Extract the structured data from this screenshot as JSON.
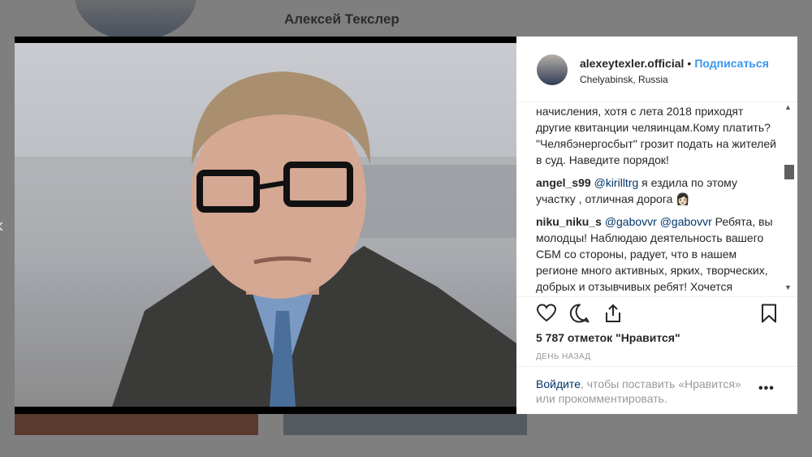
{
  "background": {
    "profile_name": "Алексей Текслер"
  },
  "post": {
    "username": "alexeytexler.official",
    "separator": "•",
    "follow_label": "Подписаться",
    "location": "Chelyabinsk, Russia",
    "comments": [
      {
        "user": "",
        "text": "начисления, хотя с лета 2018 приходят другие квитанции челяинцам.Кому платить? \"Челябэнергосбыт\" грозит подать на жителей в суд. Наведите порядок!"
      },
      {
        "user": "angel_s99",
        "mention": "@kirilltrg",
        "text": " я ездила по этому участку , отличная дорога 👩🏻"
      },
      {
        "user": "niku_niku_s",
        "mention": "@gabovvr @gabovvr",
        "text": " Ребята, вы молодцы! Наблюдаю деятельность вашего СБМ со стороны, радует, что в нашем регионе много активных, ярких, творческих, добрых и отзывчивых ребят! Хочется пожелать всем вам удачи! И то"
      }
    ],
    "likes": "5 787 отметок \"Нравится\"",
    "time": "ДЕНЬ НАЗАД",
    "login_link": "Войдите",
    "login_rest": ", чтобы поставить «Нравится» или прокомментировать.",
    "more_label": "•••"
  },
  "icons": {
    "like": "heart-icon",
    "comment": "comment-icon",
    "share": "share-icon",
    "save": "bookmark-icon",
    "prev": "chevron-left-icon"
  },
  "colors": {
    "link": "#3897f0",
    "mention": "#003569"
  }
}
